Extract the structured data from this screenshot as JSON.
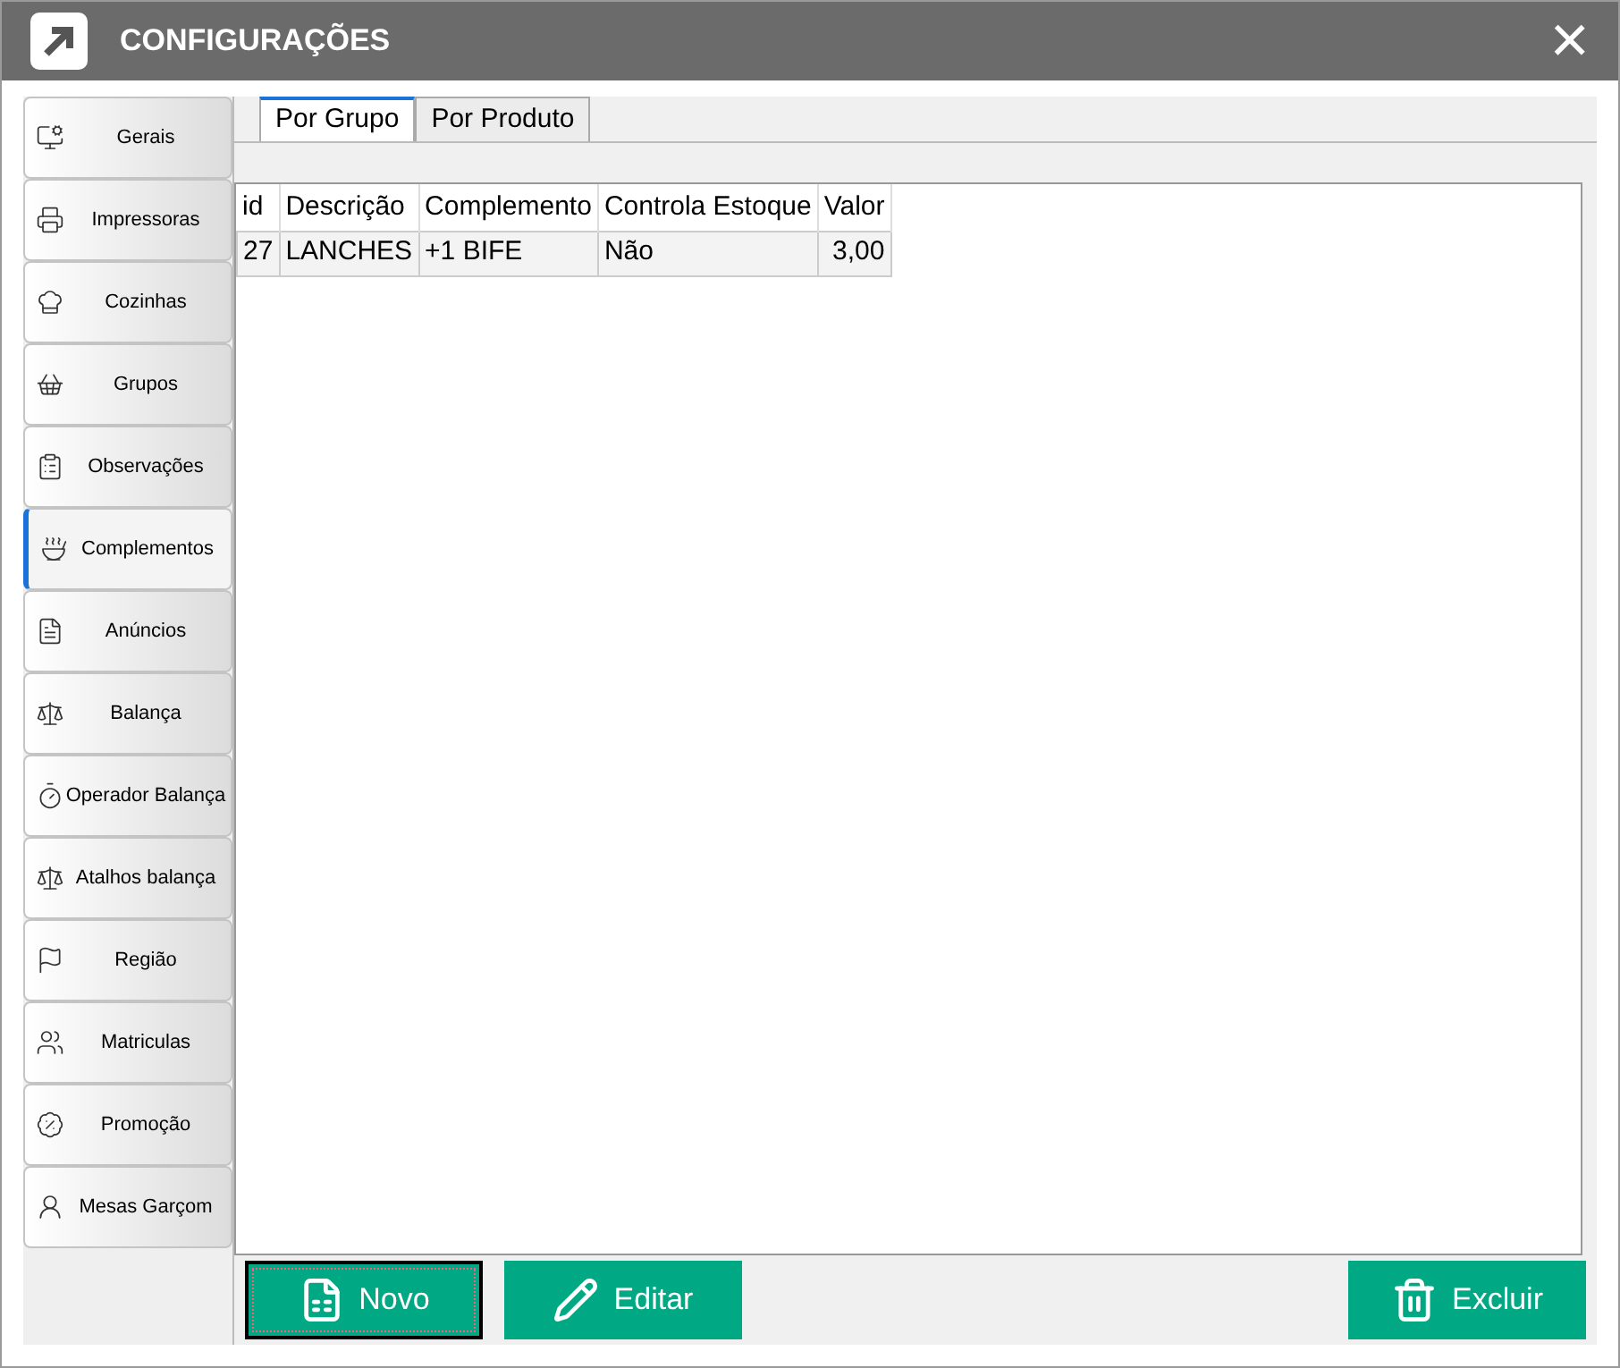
{
  "window": {
    "title": "CONFIGURAÇÕES",
    "close": "×"
  },
  "sidebar": {
    "items": [
      {
        "label": "Gerais",
        "kind": "monitor",
        "selected": false
      },
      {
        "label": "Impressoras",
        "kind": "printer",
        "selected": false
      },
      {
        "label": "Cozinhas",
        "kind": "chef",
        "selected": false
      },
      {
        "label": "Grupos",
        "kind": "basket",
        "selected": false
      },
      {
        "label": "Observações",
        "kind": "clipboard",
        "selected": false
      },
      {
        "label": "Complementos",
        "kind": "bowl",
        "selected": true
      },
      {
        "label": "Anúncios",
        "kind": "document",
        "selected": false
      },
      {
        "label": "Balança",
        "kind": "scale",
        "selected": false
      },
      {
        "label": "Operador  Balança",
        "kind": "timer",
        "selected": false
      },
      {
        "label": "Atalhos balança",
        "kind": "scale",
        "selected": false
      },
      {
        "label": "Região",
        "kind": "flag",
        "selected": false
      },
      {
        "label": "Matriculas",
        "kind": "users",
        "selected": false
      },
      {
        "label": "Promoção",
        "kind": "percent",
        "selected": false
      },
      {
        "label": "Mesas Garçom",
        "kind": "person",
        "selected": false
      }
    ]
  },
  "tabs": [
    {
      "label": "Por Grupo",
      "selected": true
    },
    {
      "label": "Por Produto",
      "selected": false
    }
  ],
  "table": {
    "columns": [
      {
        "label": "id",
        "kind": "text"
      },
      {
        "label": "Descrição",
        "kind": "text"
      },
      {
        "label": "Complemento",
        "kind": "text"
      },
      {
        "label": "Controla Estoque",
        "kind": "text"
      },
      {
        "label": "Valor",
        "kind": "number"
      }
    ],
    "rows": [
      [
        "27",
        "LANCHES",
        "+1 BIFE",
        "Não",
        "3,00"
      ]
    ]
  },
  "buttons": [
    {
      "label": "Novo",
      "kind": "new",
      "focused": true
    },
    {
      "label": "Editar",
      "kind": "edit",
      "focused": false
    },
    {
      "label": "Excluir",
      "kind": "delete",
      "focused": false
    }
  ]
}
